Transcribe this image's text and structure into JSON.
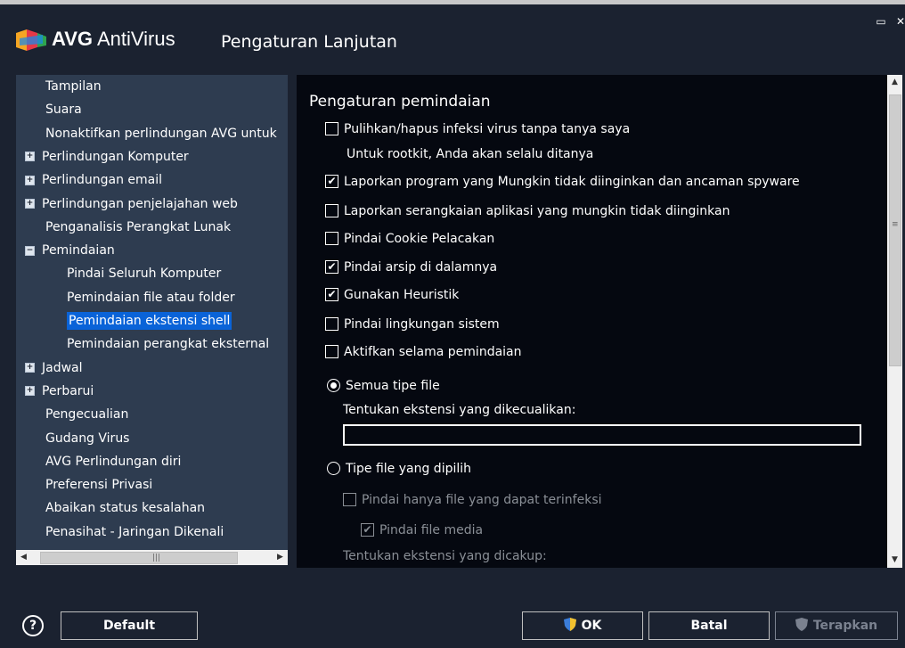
{
  "window": {
    "brand_bold": "AVG",
    "brand_rest": " AntiVirus",
    "title": "Pengaturan Lanjutan",
    "restore_icon": "restore-icon",
    "close_icon": "close-icon"
  },
  "tree": [
    {
      "label": "Tampilan",
      "indent": 0,
      "expander": ""
    },
    {
      "label": "Suara",
      "indent": 0,
      "expander": ""
    },
    {
      "label": "Nonaktifkan perlindungan AVG untuk",
      "indent": 0,
      "expander": ""
    },
    {
      "label": "Perlindungan Komputer",
      "indent": 0,
      "expander": "+"
    },
    {
      "label": "Perlindungan email",
      "indent": 0,
      "expander": "+"
    },
    {
      "label": "Perlindungan penjelajahan web",
      "indent": 0,
      "expander": "+"
    },
    {
      "label": "Penganalisis Perangkat Lunak",
      "indent": 0,
      "expander": ""
    },
    {
      "label": "Pemindaian",
      "indent": 0,
      "expander": "-"
    },
    {
      "label": "Pindai Seluruh Komputer",
      "indent": 1,
      "expander": ""
    },
    {
      "label": "Pemindaian file atau folder",
      "indent": 1,
      "expander": ""
    },
    {
      "label": "Pemindaian ekstensi shell",
      "indent": 1,
      "expander": "",
      "selected": true
    },
    {
      "label": "Pemindaian perangkat eksternal",
      "indent": 1,
      "expander": ""
    },
    {
      "label": "Jadwal",
      "indent": 0,
      "expander": "+"
    },
    {
      "label": "Perbarui",
      "indent": 0,
      "expander": "+"
    },
    {
      "label": "Pengecualian",
      "indent": 0,
      "expander": ""
    },
    {
      "label": "Gudang Virus",
      "indent": 0,
      "expander": ""
    },
    {
      "label": "AVG Perlindungan diri",
      "indent": 0,
      "expander": ""
    },
    {
      "label": "Preferensi Privasi",
      "indent": 0,
      "expander": ""
    },
    {
      "label": "Abaikan status kesalahan",
      "indent": 0,
      "expander": ""
    },
    {
      "label": "Penasihat - Jaringan Dikenali",
      "indent": 0,
      "expander": ""
    }
  ],
  "panel": {
    "title": "Pengaturan pemindaian",
    "options": [
      {
        "label": "Pulihkan/hapus infeksi virus tanpa tanya saya",
        "checked": false
      },
      {
        "label": "Laporkan program yang Mungkin tidak diinginkan dan ancaman spyware",
        "checked": true
      },
      {
        "label": "Laporkan serangkaian aplikasi yang mungkin tidak diinginkan",
        "checked": false
      },
      {
        "label": "Pindai Cookie Pelacakan",
        "checked": false
      },
      {
        "label": "Pindai arsip di dalamnya",
        "checked": true
      },
      {
        "label": "Gunakan Heuristik",
        "checked": true
      },
      {
        "label": "Pindai lingkungan sistem",
        "checked": false
      },
      {
        "label": "Aktifkan selama pemindaian",
        "checked": false
      }
    ],
    "rootkit_note": "Untuk rootkit, Anda akan selalu ditanya",
    "radio_all": "Semua tipe file",
    "exclude_label": "Tentukan ekstensi yang dikecualikan:",
    "exclude_value": "",
    "radio_selected": "Tipe file yang dipilih",
    "only_infectable": "Pindai hanya file yang dapat terinfeksi",
    "scan_media": "Pindai file media",
    "include_label": "Tentukan ekstensi yang dicakup:"
  },
  "buttons": {
    "help_icon": "?",
    "default": "Default",
    "ok": "OK",
    "cancel": "Batal",
    "apply": "Terapkan"
  }
}
